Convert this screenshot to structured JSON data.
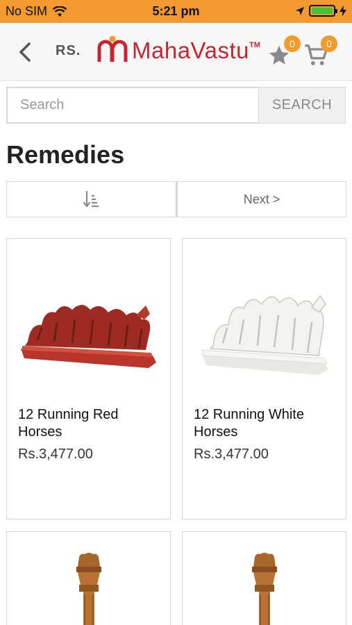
{
  "status_bar": {
    "carrier": "No SIM",
    "time": "5:21 pm"
  },
  "header": {
    "currency": "RS.",
    "logo_text": "MahaVastu",
    "logo_tm": "TM",
    "wishlist_count": "0",
    "cart_count": "0"
  },
  "search": {
    "placeholder": "Search",
    "button_label": "SEARCH"
  },
  "page_title": "Remedies",
  "pager": {
    "next_label": "Next >"
  },
  "products": [
    {
      "name": "12 Running Red Horses",
      "price": "Rs.3,477.00"
    },
    {
      "name": "12 Running White Horses",
      "price": "Rs.3,477.00"
    },
    {
      "name": "",
      "price": ""
    },
    {
      "name": "",
      "price": ""
    }
  ],
  "colors": {
    "accent": "#f29a2e",
    "brand": "#c42531"
  }
}
